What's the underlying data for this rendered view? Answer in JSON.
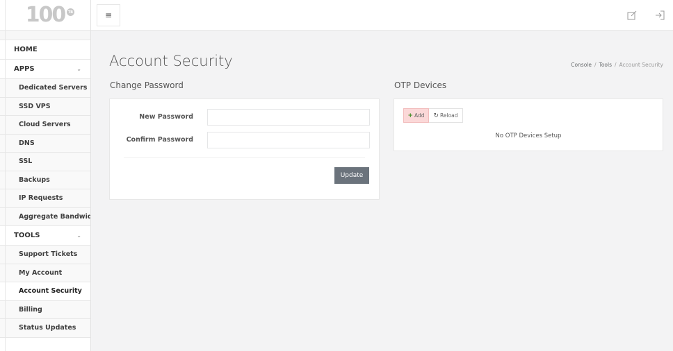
{
  "brand": {
    "logo_text": "100",
    "logo_badge": "TB"
  },
  "sidebar": {
    "home_label": "HOME",
    "apps": {
      "label": "APPS",
      "items": [
        "Dedicated Servers",
        "SSD VPS",
        "Cloud Servers",
        "DNS",
        "SSL",
        "Backups",
        "IP Requests",
        "Aggregate Bandwidth"
      ]
    },
    "tools": {
      "label": "TOOLS",
      "items": [
        "Support Tickets",
        "My Account",
        "Account Security",
        "Billing",
        "Status Updates"
      ]
    },
    "active_item": "Account Security"
  },
  "topbar": {
    "menu_icon": "hamburger-icon",
    "edit_icon": "edit-icon",
    "logout_icon": "logout-icon"
  },
  "page": {
    "title": "Account Security",
    "breadcrumb": {
      "items": [
        "Console",
        "Tools"
      ],
      "current": "Account Security"
    }
  },
  "change_password": {
    "heading": "Change Password",
    "new_password_label": "New Password",
    "new_password_value": "",
    "confirm_password_label": "Confirm Password",
    "confirm_password_value": "",
    "update_label": "Update"
  },
  "otp": {
    "heading": "OTP Devices",
    "add_label": "Add",
    "reload_label": "Reload",
    "empty_message": "No OTP Devices Setup"
  },
  "colors": {
    "update_button": "#6b737c",
    "add_button_bg": "#fbd8d8",
    "add_plus": "#3a8a1d",
    "page_bg": "#f3f3f4"
  }
}
